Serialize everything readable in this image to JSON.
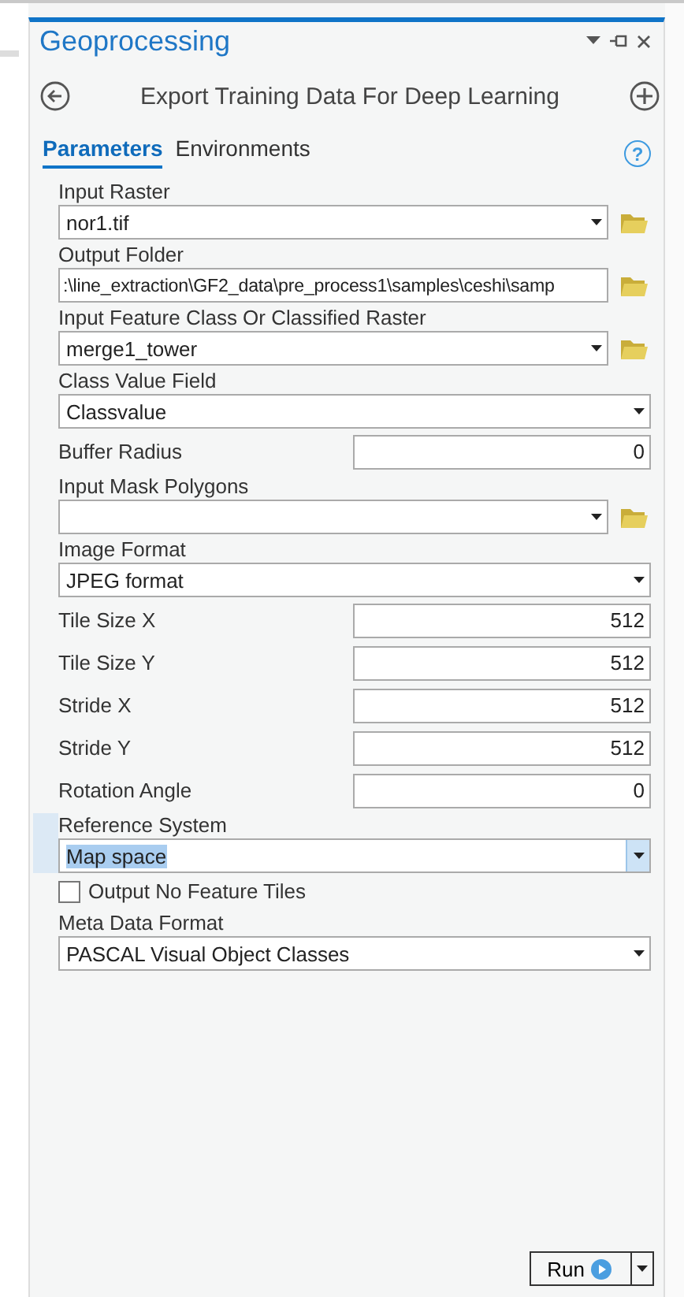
{
  "pane": {
    "title": "Geoprocessing",
    "tool_title": "Export Training Data For Deep Learning"
  },
  "tabs": [
    {
      "label": "Parameters",
      "selected": true
    },
    {
      "label": "Environments",
      "selected": false
    }
  ],
  "parameters": [
    {
      "kind": "dataset",
      "label": "Input Raster",
      "value": "nor1.tif"
    },
    {
      "kind": "folder",
      "label": "Output Folder",
      "value": ":\\line_extraction\\GF2_data\\pre_process1\\samples\\ceshi\\samp"
    },
    {
      "kind": "dataset",
      "label": "Input Feature Class Or Classified Raster",
      "value": "merge1_tower"
    },
    {
      "kind": "select",
      "label": "Class Value Field",
      "value": "Classvalue",
      "focused": false
    },
    {
      "kind": "number",
      "label": "Buffer Radius",
      "value": "0"
    },
    {
      "kind": "dataset",
      "label": "Input Mask Polygons"
    },
    {
      "kind": "select",
      "label": "Image Format",
      "value": "JPEG format",
      "focused": false
    },
    {
      "kind": "number",
      "label": "Tile Size X",
      "value": "512"
    },
    {
      "kind": "number",
      "label": "Tile Size Y",
      "value": "512"
    },
    {
      "kind": "number",
      "label": "Stride X",
      "value": "512"
    },
    {
      "kind": "number",
      "label": "Stride Y",
      "value": "512"
    },
    {
      "kind": "number",
      "label": "Rotation Angle",
      "value": "0"
    },
    {
      "kind": "select",
      "label": "Reference System",
      "value": "Map space",
      "focused": true
    },
    {
      "kind": "checkbox",
      "label": "Output No Feature Tiles",
      "checked": false
    },
    {
      "kind": "select",
      "label": "Meta Data Format",
      "value": "PASCAL Visual Object Classes",
      "focused": false
    }
  ],
  "help_button": {
    "label": "?"
  },
  "run_button": {
    "label": "Run"
  }
}
